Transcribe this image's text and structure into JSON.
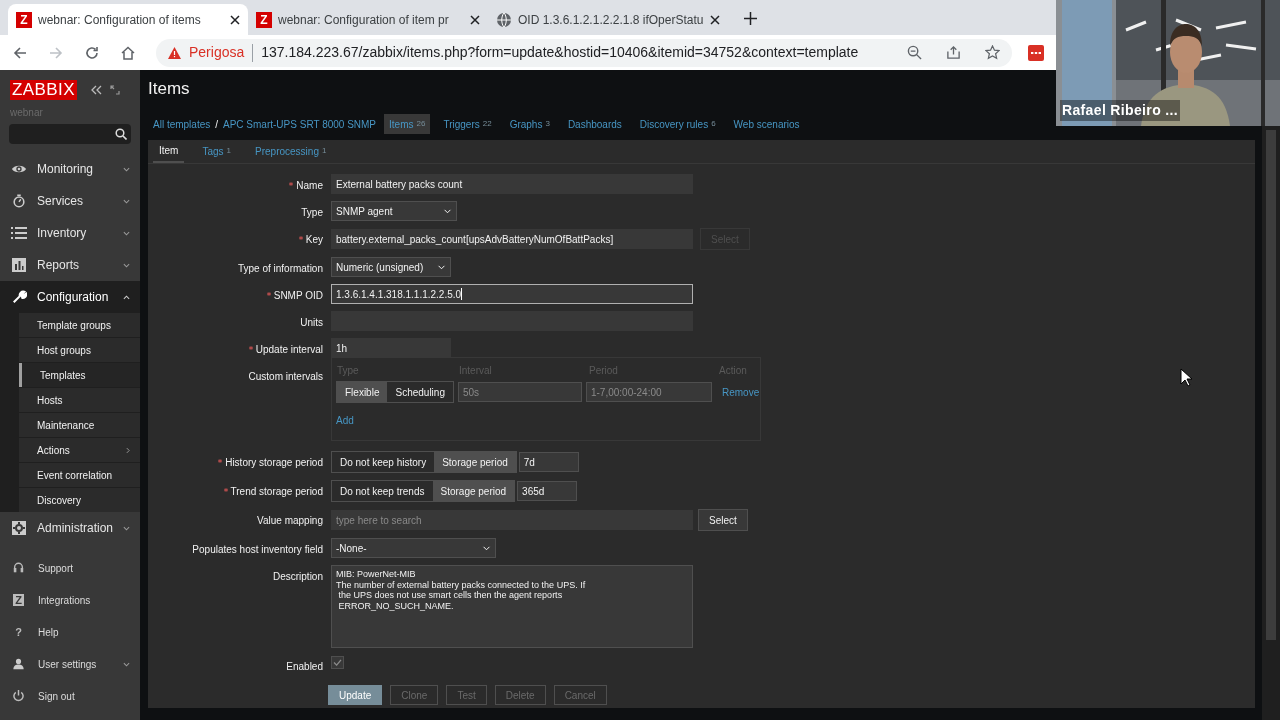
{
  "browser": {
    "tabs": [
      {
        "kind": "zabbix",
        "favicon_text": "Z",
        "title": "webnar: Configuration of items",
        "selected": true
      },
      {
        "kind": "zabbix",
        "favicon_text": "Z",
        "title": "webnar: Configuration of item pr",
        "selected": false
      },
      {
        "kind": "globe",
        "title": "OID 1.3.6.1.2.1.2.2.1.8 ifOperStatu",
        "selected": false
      }
    ],
    "address_bar": {
      "security_label": "Perigosa",
      "url": "137.184.223.67/zabbix/items.php?form=update&hostid=10406&itemid=34752&context=template"
    }
  },
  "video_tile": {
    "kind": "picture",
    "name": "Rafael Ribeiro ..."
  },
  "sidebar": {
    "logo": "ZABBIX",
    "server": "webnar",
    "menu": [
      {
        "label": "Monitoring",
        "expanded": false
      },
      {
        "label": "Services",
        "expanded": false
      },
      {
        "label": "Inventory",
        "expanded": false
      },
      {
        "label": "Reports",
        "expanded": false
      },
      {
        "label": "Configuration",
        "expanded": true,
        "children": [
          {
            "label": "Template groups",
            "selected": false,
            "has_submenu": false
          },
          {
            "label": "Host groups",
            "selected": false,
            "has_submenu": false
          },
          {
            "label": "Templates",
            "selected": true,
            "has_submenu": false
          },
          {
            "label": "Hosts",
            "selected": false,
            "has_submenu": false
          },
          {
            "label": "Maintenance",
            "selected": false,
            "has_submenu": false
          },
          {
            "label": "Actions",
            "selected": false,
            "has_submenu": true
          },
          {
            "label": "Event correlation",
            "selected": false,
            "has_submenu": false
          },
          {
            "label": "Discovery",
            "selected": false,
            "has_submenu": false
          }
        ]
      },
      {
        "label": "Administration",
        "expanded": false
      }
    ],
    "user_menu": [
      {
        "label": "Support"
      },
      {
        "label": "Integrations",
        "icon_text": "Z"
      },
      {
        "label": "Help",
        "icon_text": "?"
      },
      {
        "label": "User settings",
        "expanded": false
      },
      {
        "label": "Sign out"
      }
    ]
  },
  "page": {
    "title": "Items",
    "breadcrumbs": [
      {
        "label": "All templates"
      },
      {
        "label": "APC Smart-UPS SRT 8000 SNMP"
      }
    ],
    "separator": "/",
    "nav": [
      {
        "label": "Items",
        "count": "26",
        "selected": true
      },
      {
        "label": "Triggers",
        "count": "22",
        "selected": false
      },
      {
        "label": "Graphs",
        "count": "3",
        "selected": false
      },
      {
        "label": "Dashboards",
        "selected": false
      },
      {
        "label": "Discovery rules",
        "count": "6",
        "selected": false
      },
      {
        "label": "Web scenarios",
        "selected": false
      }
    ],
    "form_tabs": [
      {
        "label": "Item",
        "selected": true
      },
      {
        "label": "Tags",
        "count": "1",
        "selected": false
      },
      {
        "label": "Preprocessing",
        "count": "1",
        "selected": false
      }
    ],
    "fields": [
      {
        "kind": "text",
        "label": "Name",
        "required": true,
        "focused": false,
        "value": "External battery packs count"
      },
      {
        "kind": "select",
        "label": "Type",
        "required": false,
        "value": "SNMP agent"
      },
      {
        "kind": "text",
        "label": "Key",
        "required": true,
        "focused": false,
        "value": "battery.external_packs_count[upsAdvBatteryNumOfBattPacks]",
        "button": "Select"
      },
      {
        "kind": "select",
        "label": "Type of information",
        "required": false,
        "value": "Numeric (unsigned)"
      },
      {
        "kind": "text",
        "label": "SNMP OID",
        "required": true,
        "focused": true,
        "value": "1.3.6.1.4.1.318.1.1.1.2.2.5.0"
      },
      {
        "kind": "text",
        "label": "Units",
        "required": false,
        "focused": false
      },
      {
        "kind": "short_text",
        "label": "Update interval",
        "required": true,
        "focused": false,
        "value": "1h"
      },
      {
        "kind": "intervals",
        "label": "Custom intervals",
        "required": false,
        "columns": [
          "Type",
          "Interval",
          "Period",
          "Action"
        ],
        "rows": [
          {
            "modes": [
              {
                "label": "Flexible",
                "selected": true
              },
              {
                "label": "Scheduling",
                "selected": false
              }
            ],
            "interval_placeholder": "50s",
            "period_placeholder": "1-7,00:00-24:00",
            "action": "Remove"
          }
        ],
        "add": "Add"
      },
      {
        "kind": "storage",
        "label": "History storage period",
        "required": true,
        "modes": [
          {
            "label": "Do not keep history",
            "selected": false
          },
          {
            "label": "Storage period",
            "selected": true
          }
        ],
        "value": "7d"
      },
      {
        "kind": "storage",
        "label": "Trend storage period",
        "required": true,
        "modes": [
          {
            "label": "Do not keep trends",
            "selected": false
          },
          {
            "label": "Storage period",
            "selected": true
          }
        ],
        "value": "365d"
      },
      {
        "kind": "search",
        "label": "Value mapping",
        "required": false,
        "placeholder": "type here to search",
        "button": "Select"
      },
      {
        "kind": "select",
        "label": "Populates host inventory field",
        "required": false,
        "value": "-None-"
      },
      {
        "kind": "textarea",
        "label": "Description",
        "required": false,
        "value": "MIB: PowerNet-MIB\nThe number of external battery packs connected to the UPS. If\n the UPS does not use smart cells then the agent reports\n ERROR_NO_SUCH_NAME."
      },
      {
        "kind": "checkbox",
        "label": "Enabled",
        "required": false,
        "checked": true
      }
    ],
    "buttons": [
      {
        "label": "Update",
        "kind": "primary"
      },
      {
        "label": "Clone",
        "kind": "alt"
      },
      {
        "label": "Test",
        "kind": "alt"
      },
      {
        "label": "Delete",
        "kind": "alt"
      },
      {
        "label": "Cancel",
        "kind": "alt"
      }
    ]
  }
}
